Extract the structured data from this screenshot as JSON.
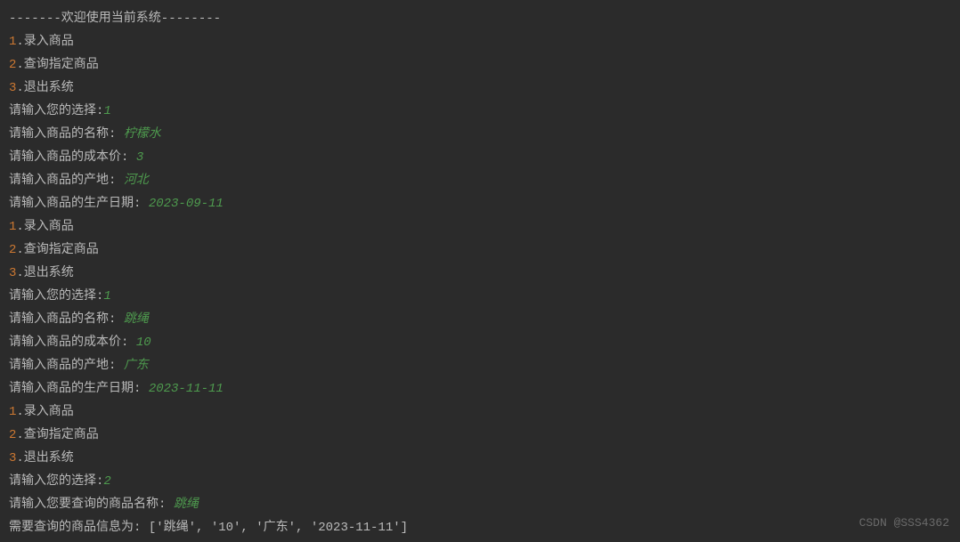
{
  "header": "-------欢迎使用当前系统--------",
  "menu": {
    "item1_num": "1",
    "item1_label": ".录入商品",
    "item2_num": "2",
    "item2_label": ".查询指定商品",
    "item3_num": "3",
    "item3_label": ".退出系统"
  },
  "prompts": {
    "choice": "请输入您的选择:",
    "product_name": "请输入商品的名称: ",
    "product_cost": "请输入商品的成本价: ",
    "product_origin": "请输入商品的产地: ",
    "product_date": "请输入商品的生产日期: ",
    "query_name": "请输入您要查询的商品名称: ",
    "query_result_prefix": "需要查询的商品信息为: "
  },
  "session1": {
    "choice": "1",
    "name": "柠檬水",
    "cost": "3",
    "origin": "河北",
    "date": "2023-09-11"
  },
  "session2": {
    "choice": "1",
    "name": "跳绳",
    "cost": "10",
    "origin": "广东",
    "date": "2023-11-11"
  },
  "session3": {
    "choice": "2",
    "query_name": "跳绳",
    "result": "['跳绳', '10', '广东', '2023-11-11']"
  },
  "watermark": "CSDN @SSS4362"
}
